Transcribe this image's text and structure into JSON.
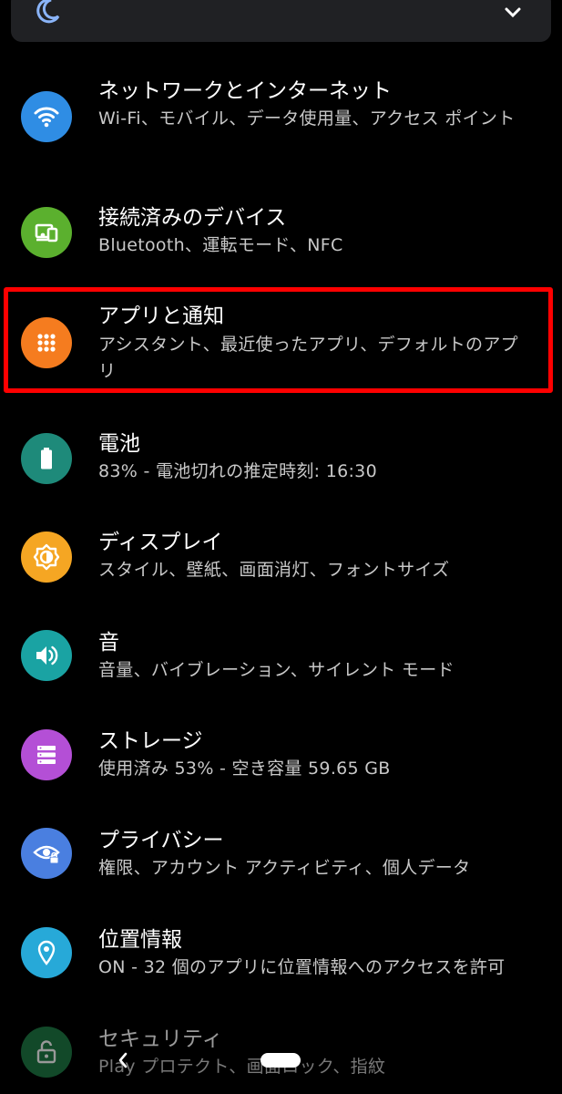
{
  "top_card": {
    "moon_icon": "moon-icon",
    "chevron_icon": "chevron-down-icon"
  },
  "items": [
    {
      "title": "ネットワークとインターネット",
      "subtitle": "Wi-Fi、モバイル、データ使用量、アクセス ポイント",
      "icon": "wifi-icon",
      "color": "#2f8de4"
    },
    {
      "title": "接続済みのデバイス",
      "subtitle": "Bluetooth、運転モード、NFC",
      "icon": "devices-icon",
      "color": "#5bb02e"
    },
    {
      "title": "アプリと通知",
      "subtitle": "アシスタント、最近使ったアプリ、デフォルトのアプリ",
      "icon": "apps-grid-icon",
      "color": "#f57c1f"
    },
    {
      "title": "電池",
      "subtitle": "83% - 電池切れの推定時刻: 16:30",
      "icon": "battery-icon",
      "color": "#1e8a7a"
    },
    {
      "title": "ディスプレイ",
      "subtitle": "スタイル、壁紙、画面消灯、フォントサイズ",
      "icon": "brightness-icon",
      "color": "#f5a623"
    },
    {
      "title": "音",
      "subtitle": "音量、バイブレーション、サイレント モード",
      "icon": "volume-icon",
      "color": "#1aa3a3"
    },
    {
      "title": "ストレージ",
      "subtitle": "使用済み 53% - 空き容量 59.65 GB",
      "icon": "storage-icon",
      "color": "#b44fd6"
    },
    {
      "title": "プライバシー",
      "subtitle": "権限、アカウント アクティビティ、個人データ",
      "icon": "privacy-eye-icon",
      "color": "#4a7fe0"
    },
    {
      "title": "位置情報",
      "subtitle": "ON - 32 個のアプリに位置情報へのアクセスを許可",
      "icon": "location-pin-icon",
      "color": "#27a9d8"
    },
    {
      "title": "セキュリティ",
      "subtitle": "Play プロテクト、画面ロック、指紋",
      "icon": "lock-open-icon",
      "color": "#1e7a45"
    }
  ],
  "highlight_color": "#ff0000"
}
